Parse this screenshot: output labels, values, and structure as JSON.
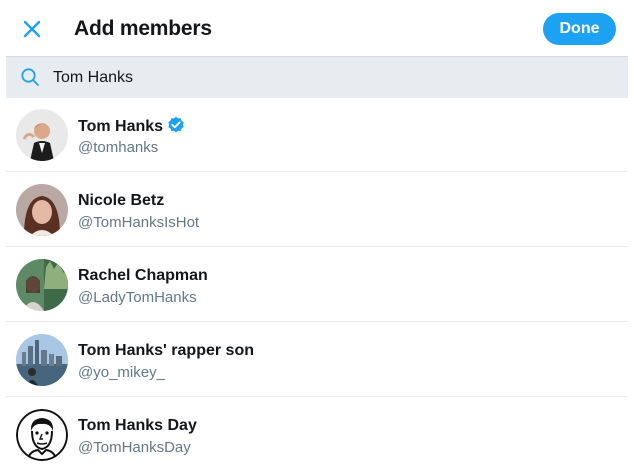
{
  "header": {
    "title": "Add members",
    "done_label": "Done",
    "close_icon": "close-icon"
  },
  "search": {
    "value": "Tom Hanks",
    "icon": "search-icon"
  },
  "results": [
    {
      "name": "Tom Hanks",
      "handle": "@tomhanks",
      "verified": true
    },
    {
      "name": "Nicole Betz",
      "handle": "@TomHanksIsHot",
      "verified": false
    },
    {
      "name": "Rachel Chapman",
      "handle": "@LadyTomHanks",
      "verified": false
    },
    {
      "name": "Tom Hanks' rapper son",
      "handle": "@yo_mikey_",
      "verified": false
    },
    {
      "name": "Tom Hanks Day",
      "handle": "@TomHanksDay",
      "verified": false
    }
  ],
  "colors": {
    "accent": "#1da1f2",
    "search_bg": "#e6ecf0",
    "secondary_text": "#657786"
  }
}
